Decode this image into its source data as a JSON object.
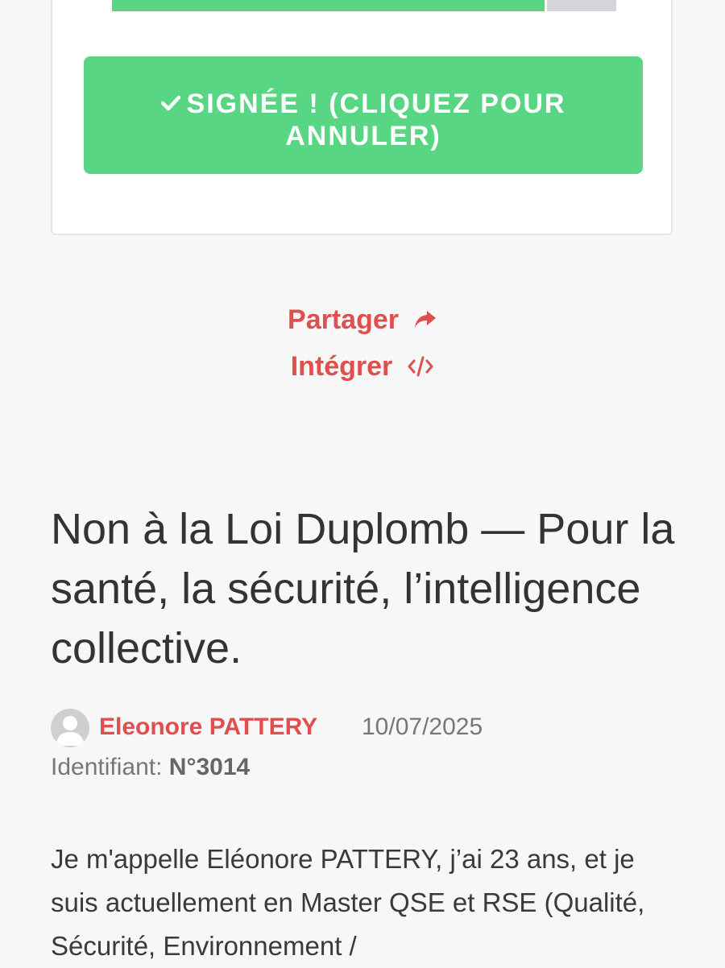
{
  "sign_button": {
    "check_icon": "check-icon",
    "label": "SIGNÉE ! (CLIQUEZ POUR ANNULER)"
  },
  "progress": {
    "fill_fraction": 0.858
  },
  "actions": {
    "share_label": "Partager",
    "share_icon": "share-arrow-icon",
    "embed_label": "Intégrer",
    "embed_icon": "code-icon"
  },
  "petition": {
    "title": "Non à la Loi Duplomb — Pour la santé, la sécurité, l’intelligence collective.",
    "author": "Eleonore PATTERY",
    "date": "10/07/2025",
    "identifier_label": "Identifiant:",
    "identifier_value": "N°3014",
    "body_excerpt": "Je m'appelle Eléonore PATTERY, j’ai 23 ans, et je suis actuellement en Master QSE et RSE (Qualité, Sécurité, Environnement /"
  },
  "colors": {
    "accent_green": "#59d684",
    "accent_red": "#e04f4f",
    "background": "#f7f7f7"
  }
}
